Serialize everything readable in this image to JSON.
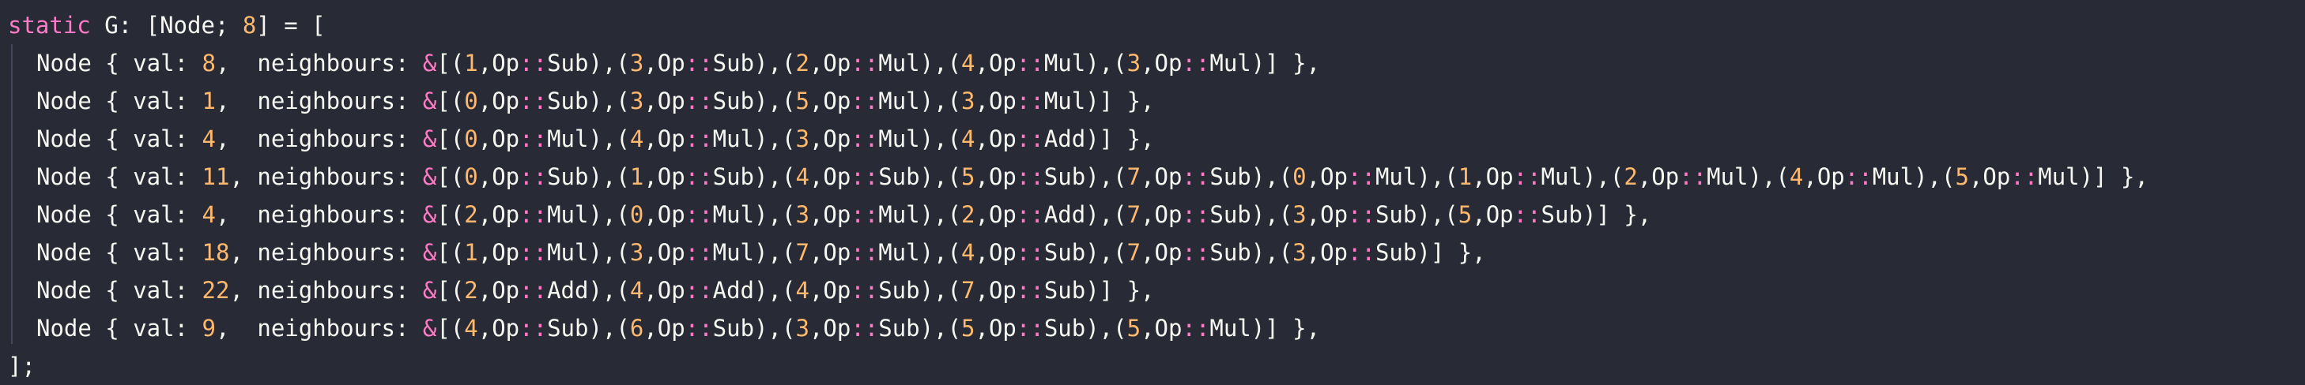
{
  "colors": {
    "background": "#282a36",
    "foreground": "#f8f8f2",
    "keyword": "#ff79c6",
    "number": "#ffb86c",
    "indent_guide": "#44475a"
  },
  "code": {
    "line1_keyword": "static",
    "line1_rest_a": " G: [Node; ",
    "line1_number": "8",
    "line1_rest_b": "] = [",
    "node_prefix": "Node { val: ",
    "neighbours_label": "neighbours: ",
    "amp": "&",
    "closing": "];",
    "nodes": [
      {
        "val": "8",
        "edges": [
          [
            "1",
            "Sub"
          ],
          [
            "3",
            "Sub"
          ],
          [
            "2",
            "Mul"
          ],
          [
            "4",
            "Mul"
          ],
          [
            "3",
            "Mul"
          ]
        ]
      },
      {
        "val": "1",
        "edges": [
          [
            "0",
            "Sub"
          ],
          [
            "3",
            "Sub"
          ],
          [
            "5",
            "Mul"
          ],
          [
            "3",
            "Mul"
          ]
        ]
      },
      {
        "val": "4",
        "edges": [
          [
            "0",
            "Mul"
          ],
          [
            "4",
            "Mul"
          ],
          [
            "3",
            "Mul"
          ],
          [
            "4",
            "Add"
          ]
        ]
      },
      {
        "val": "11",
        "edges": [
          [
            "0",
            "Sub"
          ],
          [
            "1",
            "Sub"
          ],
          [
            "4",
            "Sub"
          ],
          [
            "5",
            "Sub"
          ],
          [
            "7",
            "Sub"
          ],
          [
            "0",
            "Mul"
          ],
          [
            "1",
            "Mul"
          ],
          [
            "2",
            "Mul"
          ],
          [
            "4",
            "Mul"
          ],
          [
            "5",
            "Mul"
          ]
        ]
      },
      {
        "val": "4",
        "edges": [
          [
            "2",
            "Mul"
          ],
          [
            "0",
            "Mul"
          ],
          [
            "3",
            "Mul"
          ],
          [
            "2",
            "Add"
          ],
          [
            "7",
            "Sub"
          ],
          [
            "3",
            "Sub"
          ],
          [
            "5",
            "Sub"
          ]
        ]
      },
      {
        "val": "18",
        "edges": [
          [
            "1",
            "Mul"
          ],
          [
            "3",
            "Mul"
          ],
          [
            "7",
            "Mul"
          ],
          [
            "4",
            "Sub"
          ],
          [
            "7",
            "Sub"
          ],
          [
            "3",
            "Sub"
          ]
        ]
      },
      {
        "val": "22",
        "edges": [
          [
            "2",
            "Add"
          ],
          [
            "4",
            "Add"
          ],
          [
            "4",
            "Sub"
          ],
          [
            "7",
            "Sub"
          ]
        ]
      },
      {
        "val": "9",
        "edges": [
          [
            "4",
            "Sub"
          ],
          [
            "6",
            "Sub"
          ],
          [
            "3",
            "Sub"
          ],
          [
            "5",
            "Sub"
          ],
          [
            "5",
            "Mul"
          ]
        ]
      }
    ]
  }
}
